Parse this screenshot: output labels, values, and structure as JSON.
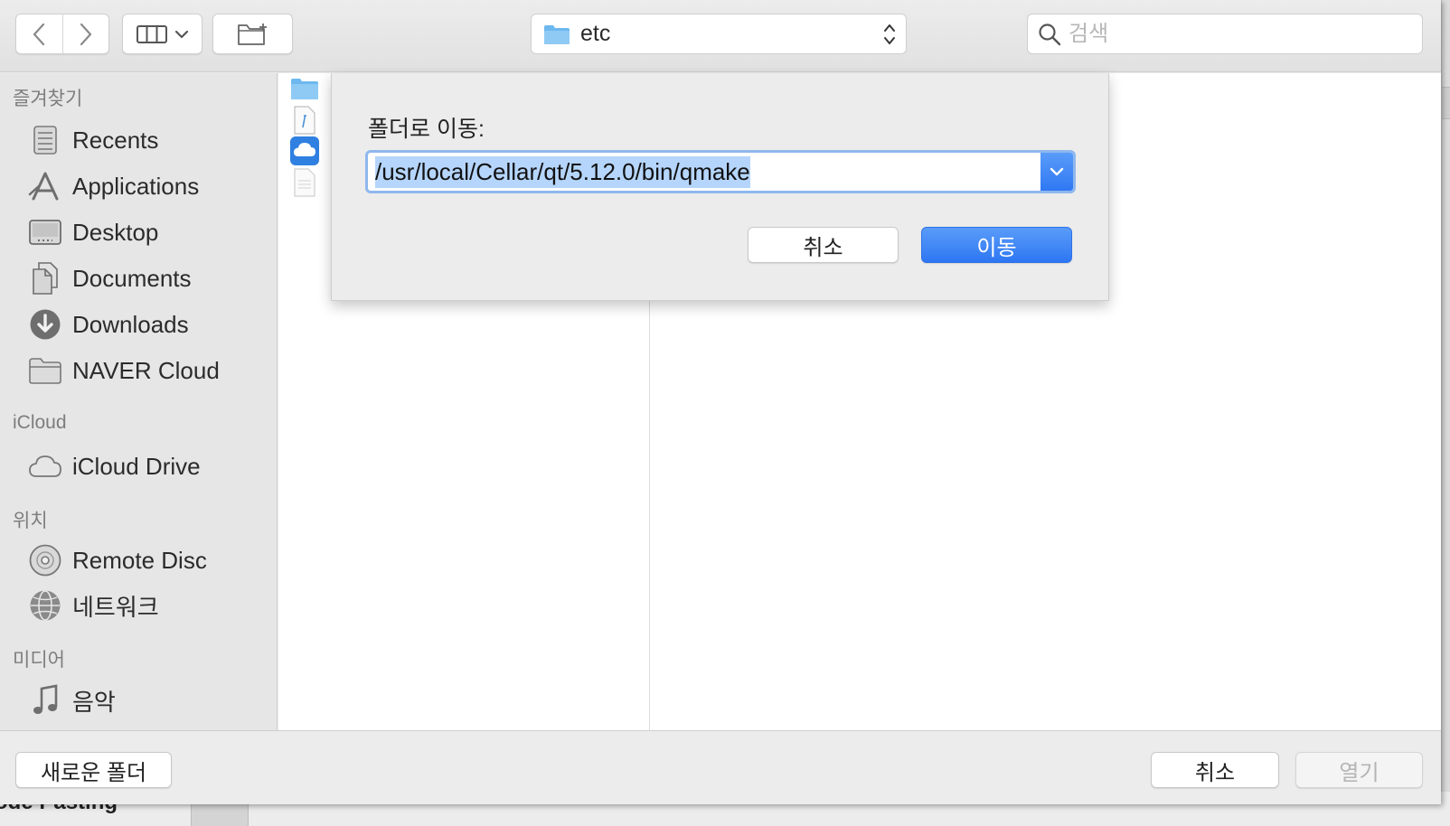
{
  "toolbar": {
    "back_icon": "chevron-left-icon",
    "forward_icon": "chevron-right-icon",
    "view_icon": "column-view-icon",
    "new_folder_icon": "new-folder-icon",
    "current_folder": "etc",
    "search_placeholder": "검색"
  },
  "sidebar": {
    "favorites_header": "즐겨찾기",
    "favorites": [
      {
        "label": "Recents",
        "icon": "recents-icon"
      },
      {
        "label": "Applications",
        "icon": "applications-icon"
      },
      {
        "label": "Desktop",
        "icon": "desktop-icon"
      },
      {
        "label": "Documents",
        "icon": "documents-icon"
      },
      {
        "label": "Downloads",
        "icon": "downloads-icon"
      },
      {
        "label": "NAVER Cloud",
        "icon": "folder-icon"
      }
    ],
    "icloud_header": "iCloud",
    "icloud": [
      {
        "label": "iCloud Drive",
        "icon": "cloud-icon"
      }
    ],
    "locations_header": "위치",
    "locations": [
      {
        "label": "Remote Disc",
        "icon": "disc-icon"
      },
      {
        "label": "네트워크",
        "icon": "network-icon"
      }
    ],
    "media_header": "미디어",
    "media": [
      {
        "label": "음악",
        "icon": "music-note-icon"
      }
    ]
  },
  "goto_dialog": {
    "title": "폴더로 이동:",
    "path_value": "/usr/local/Cellar/qt/5.12.0/bin/qmake",
    "cancel_label": "취소",
    "go_label": "이동"
  },
  "bottom_bar": {
    "new_folder_label": "새로운 폴더",
    "cancel_label": "취소",
    "open_label": "열기"
  },
  "background": {
    "partial_text": "ode Pasting"
  },
  "colors": {
    "accent": "#3a85f5",
    "selection": "#b5d5fc",
    "sidebar_bg": "#e6e6e6",
    "toolbar_bg": "#ececec"
  }
}
